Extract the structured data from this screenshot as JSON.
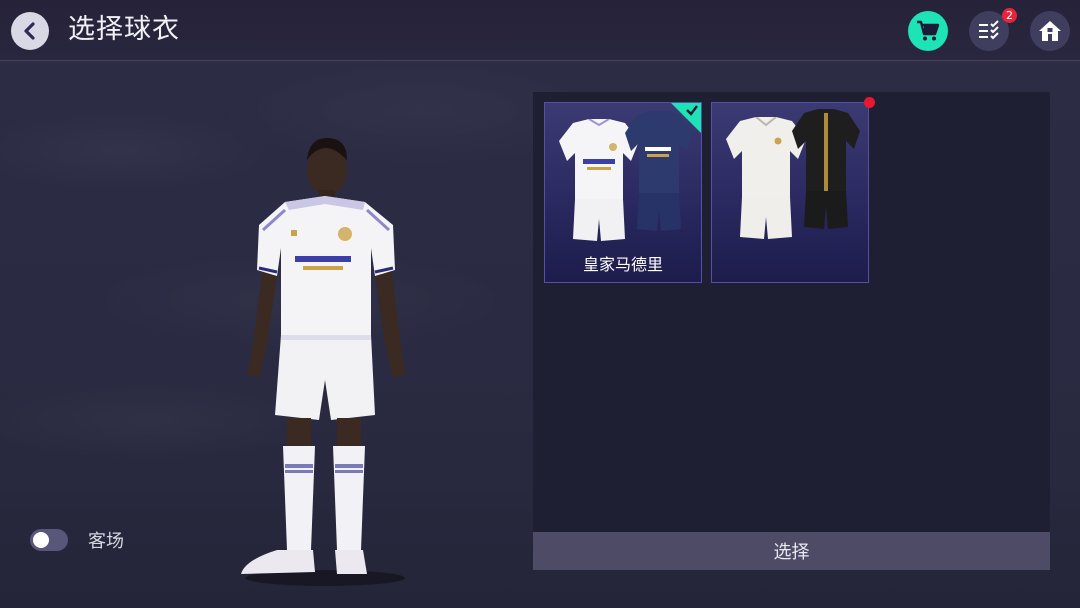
{
  "header": {
    "title": "选择球衣",
    "back_icon": "chevron-left-icon",
    "cart_icon": "cart-icon",
    "tasks_icon": "task-list-icon",
    "tasks_badge": "2",
    "home_icon": "home-icon",
    "cart_color": "#1de3b7"
  },
  "toggle": {
    "label": "客场",
    "state": "off"
  },
  "kits": [
    {
      "name": "皇家马德里",
      "selected": true
    },
    {
      "name": "",
      "selected": false,
      "new": true
    }
  ],
  "select_button": {
    "label": "选择"
  },
  "colors": {
    "accent": "#1de3b7",
    "badge": "#e8243b",
    "card_border": "#5350a6"
  }
}
